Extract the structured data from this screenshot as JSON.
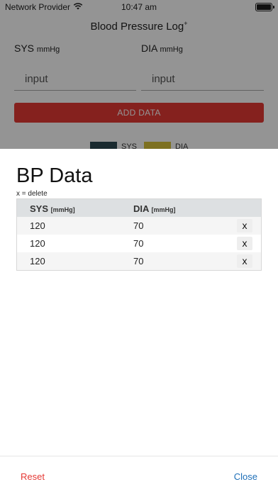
{
  "status_bar": {
    "carrier": "Network Provider",
    "time": "10:47 am",
    "wifi_icon": "wifi-icon",
    "battery_icon": "battery-full-icon"
  },
  "background_app": {
    "title": "Blood Pressure Log",
    "title_sup": "+",
    "sys_label": "SYS",
    "sys_unit": "mmHg",
    "dia_label": "DIA",
    "dia_unit": "mmHg",
    "sys_input_value": "input",
    "dia_input_value": "input",
    "add_button_label": "ADD DATA",
    "legend": [
      {
        "label": "SYS",
        "color": "#2e4a54"
      },
      {
        "label": "DIA",
        "color": "#d8c13a"
      }
    ]
  },
  "sheet": {
    "title": "BP Data",
    "hint": "x = delete",
    "columns": [
      {
        "label": "SYS",
        "unit": "[mmHg]"
      },
      {
        "label": "DIA",
        "unit": "[mmHg]"
      }
    ],
    "rows": [
      {
        "sys": "120",
        "dia": "70",
        "delete": "x"
      },
      {
        "sys": "120",
        "dia": "70",
        "delete": "x"
      },
      {
        "sys": "120",
        "dia": "70",
        "delete": "x"
      }
    ],
    "reset_label": "Reset",
    "close_label": "Close"
  },
  "colors": {
    "accent_red": "#e53935",
    "close_blue": "#1e6fb8",
    "header_gray": "#dde0e2"
  }
}
